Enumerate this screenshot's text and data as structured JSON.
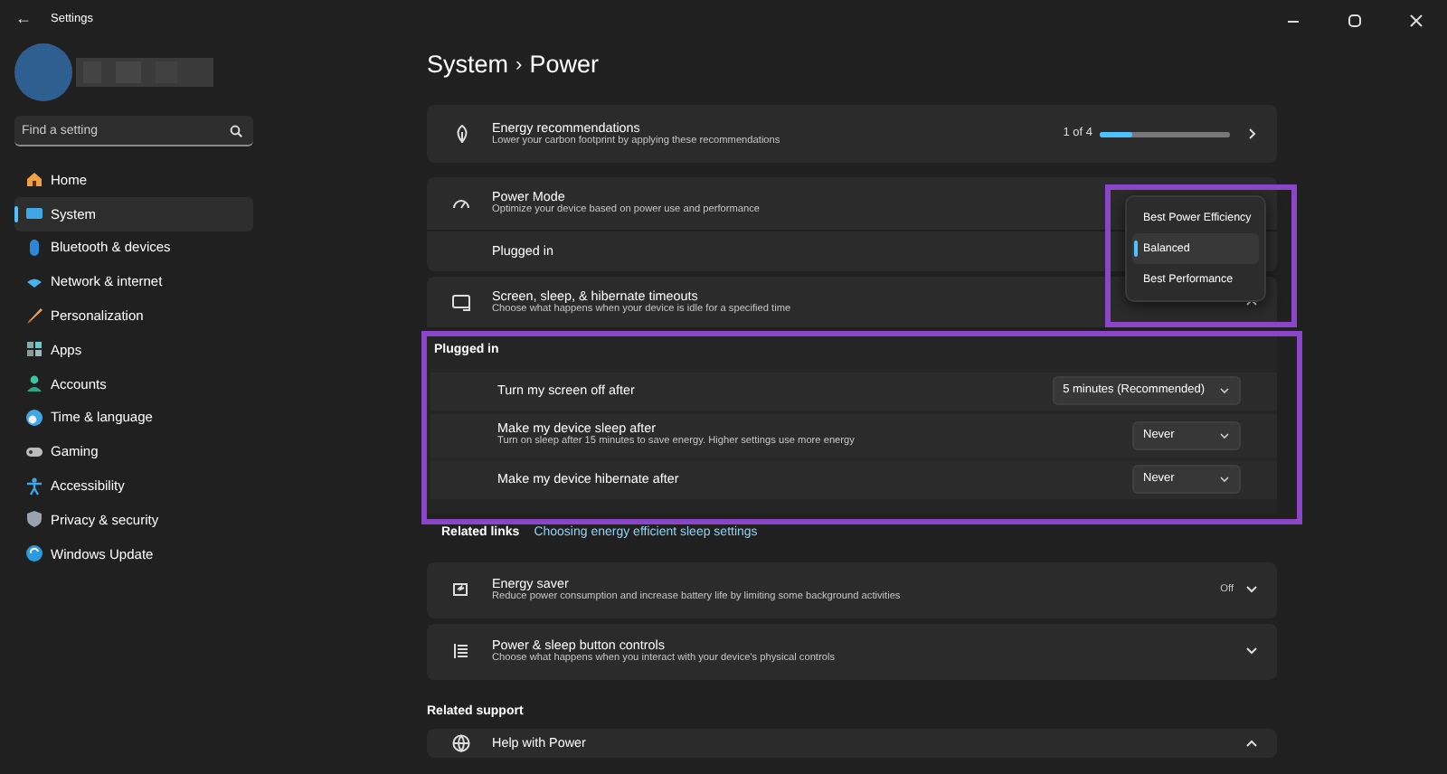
{
  "window": {
    "title": "Settings",
    "back": "←",
    "controls": [
      {
        "kind": "minimize"
      },
      {
        "kind": "maximize"
      },
      {
        "kind": "close"
      }
    ]
  },
  "sidebar": {
    "search": {
      "placeholder": "Find a setting"
    },
    "items": [
      {
        "label": "Home",
        "kind": "home",
        "selected": false
      },
      {
        "label": "System",
        "kind": "system",
        "selected": true
      },
      {
        "label": "Bluetooth & devices",
        "kind": "bluetooth",
        "selected": false
      },
      {
        "label": "Network & internet",
        "kind": "network",
        "selected": false
      },
      {
        "label": "Personalization",
        "kind": "brush",
        "selected": false
      },
      {
        "label": "Apps",
        "kind": "apps",
        "selected": false
      },
      {
        "label": "Accounts",
        "kind": "person",
        "selected": false
      },
      {
        "label": "Time & language",
        "kind": "clock",
        "selected": false
      },
      {
        "label": "Gaming",
        "kind": "gamepad",
        "selected": false
      },
      {
        "label": "Accessibility",
        "kind": "access",
        "selected": false
      },
      {
        "label": "Privacy & security",
        "kind": "shield",
        "selected": false
      },
      {
        "label": "Windows Update",
        "kind": "update",
        "selected": false
      }
    ]
  },
  "breadcrumb": {
    "parent": "System",
    "separator": "›",
    "current": "Power"
  },
  "energy_recommendations": {
    "title": "Energy recommendations",
    "subtitle": "Lower your carbon footprint by applying these recommendations",
    "count": "1 of 4",
    "level": 0.25
  },
  "power_mode": {
    "title": "Power Mode",
    "subtitle": "Optimize your device based on power use and performance",
    "row_label": "Plugged in",
    "options": [
      {
        "label": "Best Power Efficiency",
        "selected": false
      },
      {
        "label": "Balanced",
        "selected": true
      },
      {
        "label": "Best Performance",
        "selected": false
      }
    ]
  },
  "screen_sleep": {
    "title": "Screen, sleep, & hibernate timeouts",
    "subtitle": "Choose what happens when your device is idle for a specified time",
    "expanded": true,
    "section": "Plugged in",
    "rows": [
      {
        "label": "Turn my screen off after",
        "value": "5 minutes (Recommended)"
      },
      {
        "label": "Make my device sleep after",
        "hint": "Turn on sleep after 15 minutes to save energy. Higher settings use more energy",
        "value": "Never"
      },
      {
        "label": "Make my device hibernate after",
        "value": "Never"
      }
    ]
  },
  "related_links": {
    "label": "Related links",
    "link": "Choosing energy efficient sleep settings"
  },
  "cards": [
    {
      "kind": "saver",
      "title": "Energy saver",
      "subtitle": "Reduce power consumption and increase battery life by limiting some background activities",
      "status": "Off",
      "expanded": false
    },
    {
      "kind": "buttons",
      "title": "Power & sleep button controls",
      "subtitle": "Choose what happens when you interact with your device's physical controls",
      "expanded": false
    }
  ],
  "related_support": {
    "heading": "Related support",
    "items": [
      {
        "title": "Help with Power",
        "expanded": true
      }
    ]
  }
}
